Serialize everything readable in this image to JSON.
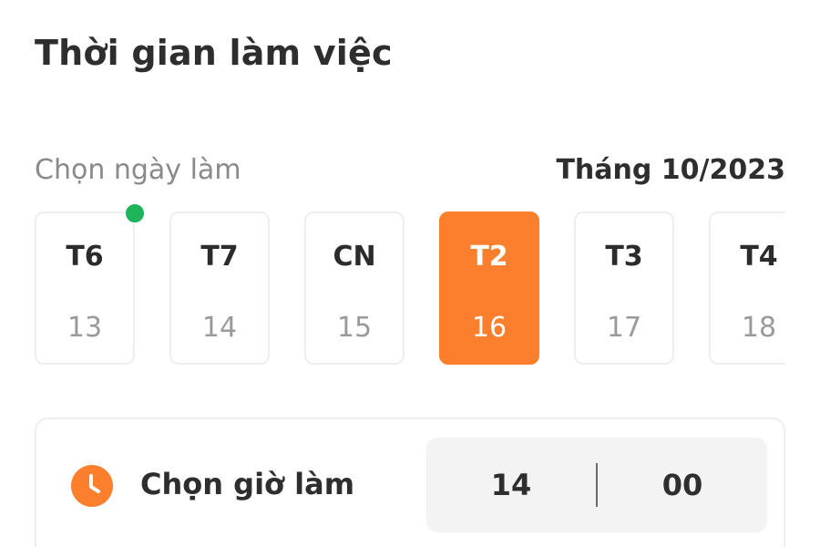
{
  "header": {
    "title": "Thời gian làm việc"
  },
  "date_picker": {
    "subtitle": "Chọn ngày làm",
    "month_label": "Tháng 10/2023",
    "days": [
      {
        "weekday": "T6",
        "day": "13",
        "selected": false,
        "has_indicator": true
      },
      {
        "weekday": "T7",
        "day": "14",
        "selected": false,
        "has_indicator": false
      },
      {
        "weekday": "CN",
        "day": "15",
        "selected": false,
        "has_indicator": false
      },
      {
        "weekday": "T2",
        "day": "16",
        "selected": true,
        "has_indicator": false
      },
      {
        "weekday": "T3",
        "day": "17",
        "selected": false,
        "has_indicator": false
      },
      {
        "weekday": "T4",
        "day": "18",
        "selected": false,
        "has_indicator": false
      }
    ]
  },
  "time_picker": {
    "label": "Chọn giờ làm",
    "icon": "clock-icon",
    "hour": "14",
    "minute": "00"
  },
  "colors": {
    "accent": "#fb7f2d",
    "indicator": "#1fb35a",
    "text_dark": "#2e2e2e",
    "text_muted": "#9a9a9a",
    "border": "#eeeeee"
  }
}
